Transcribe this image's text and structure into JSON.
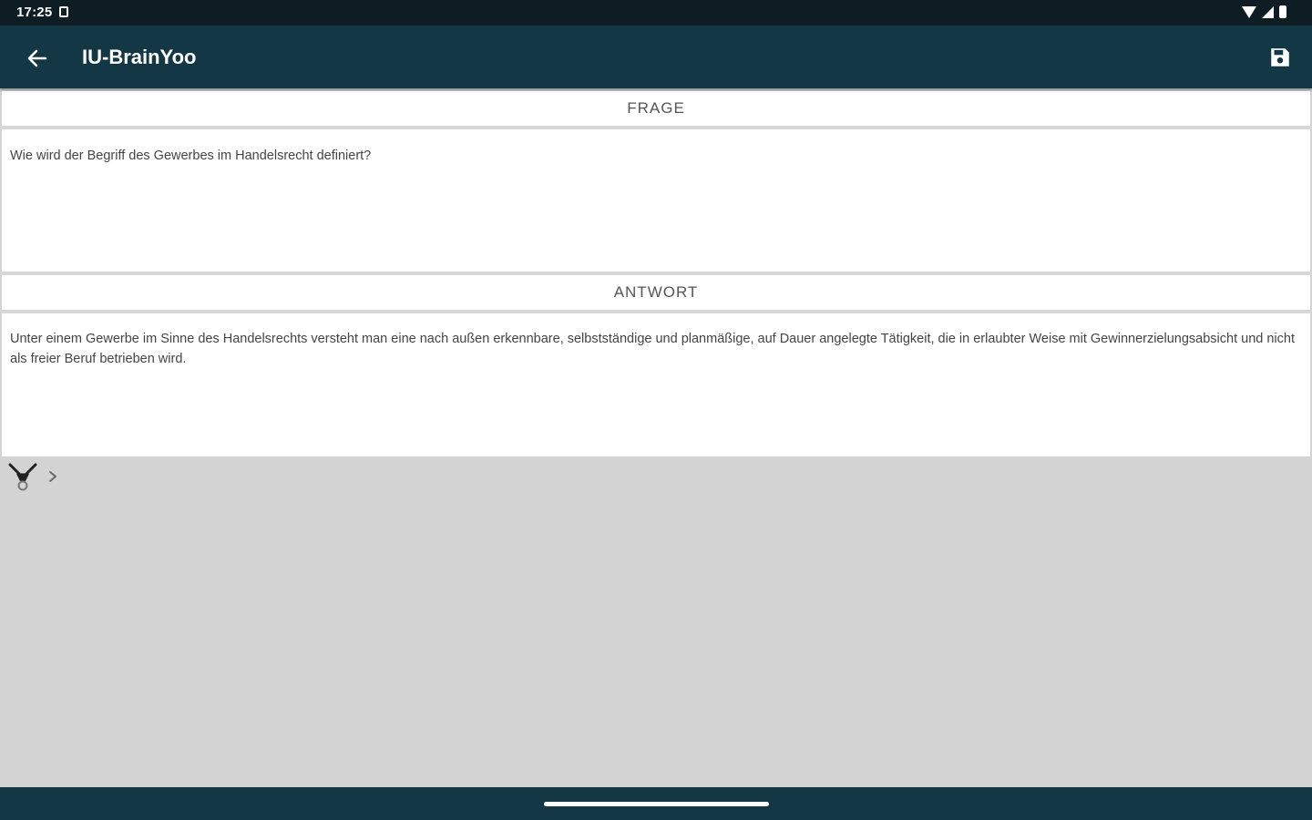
{
  "status_bar": {
    "time": "17:25"
  },
  "app_bar": {
    "title": "IU-BrainYoo",
    "back_icon": "arrow-left-icon",
    "save_icon": "floppy-disk-icon"
  },
  "question": {
    "header": "FRAGE",
    "text": "Wie wird der Begriff des Gewerbes im Handelsrecht definiert?"
  },
  "answer": {
    "header": "ANTWORT",
    "text": "Unter einem Gewerbe im Sinne des Handelsrechts versteht man eine nach außen erkennbare, selbstständige und planmäßige, auf Dauer angelegte Tätigkeit, die in erlaubter Weise mit Gewinnerzielungsabsicht und nicht als freier Beruf betrieben wird."
  },
  "toolbar": {
    "tool_icon": "funnel-tool-icon",
    "expand_icon": "chevron-right-icon"
  },
  "colors": {
    "app_bar": "#143746",
    "status_bar": "#0e1c24",
    "background": "#d3d3d3"
  }
}
